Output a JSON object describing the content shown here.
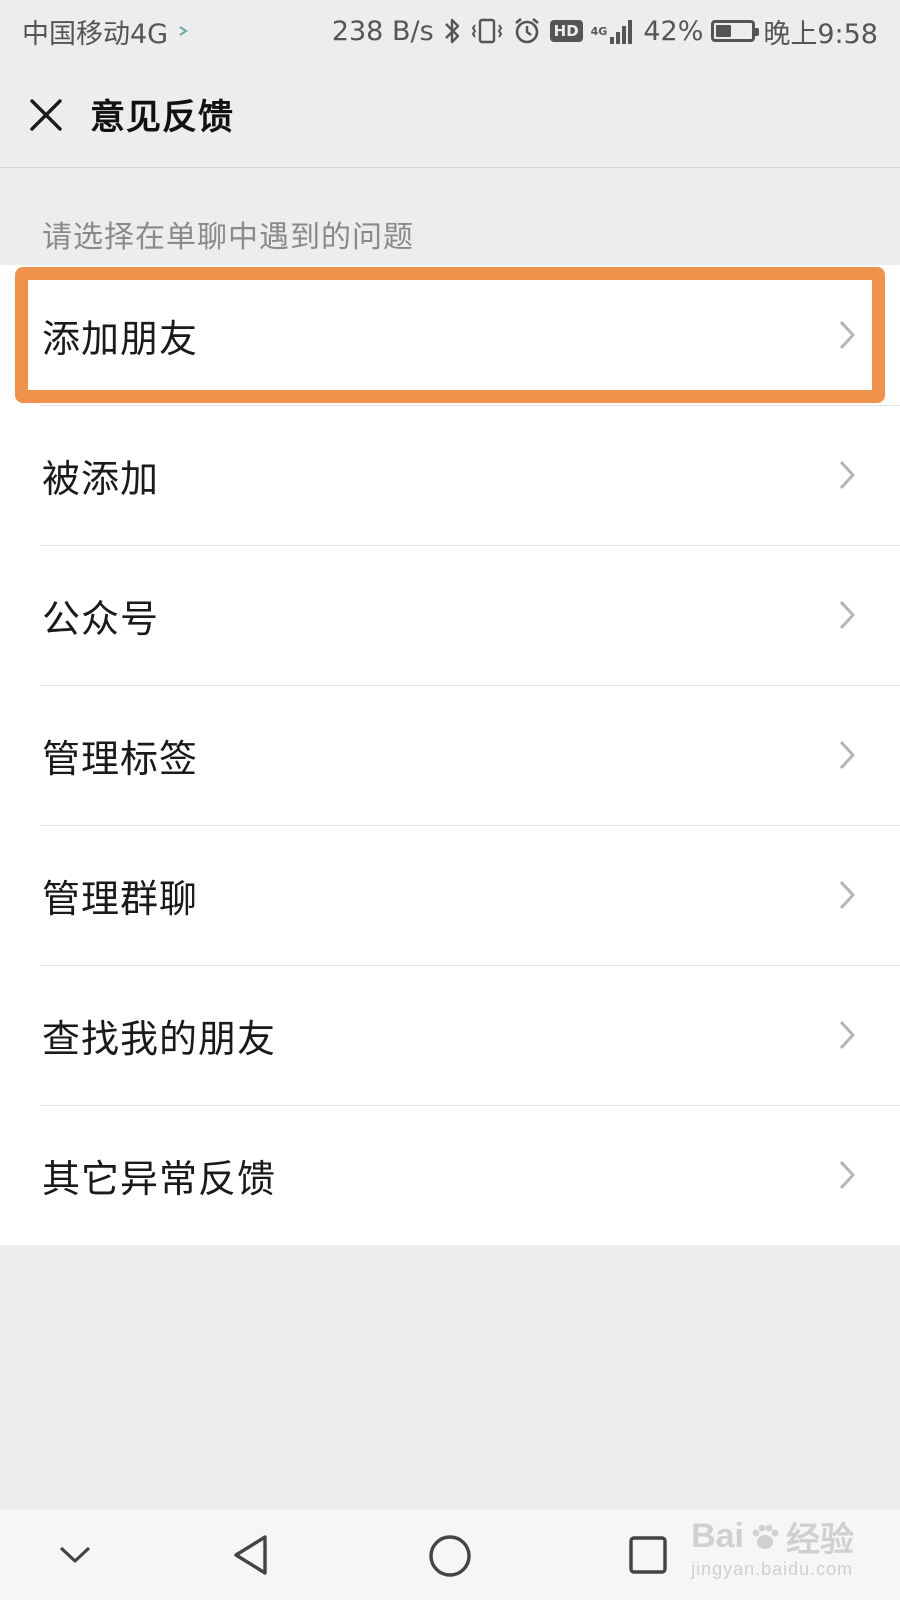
{
  "status_bar": {
    "carrier": "中国移动4G",
    "net_speed": "238 B/s",
    "network_badge": "HD",
    "signal_label": "4G",
    "battery_percent": "42%",
    "battery_level": 0.42,
    "time": "晚上9:58",
    "icons": [
      "bluetooth-icon",
      "vibrate-icon",
      "alarm-icon",
      "hd-icon",
      "signal-icon",
      "battery-icon"
    ]
  },
  "header": {
    "close_icon": "close-icon",
    "title": "意见反馈"
  },
  "section": {
    "caption": "请选择在单聊中遇到的问题"
  },
  "list": {
    "items": [
      {
        "label": "添加朋友",
        "highlighted": true
      },
      {
        "label": "被添加"
      },
      {
        "label": "公众号"
      },
      {
        "label": "管理标签"
      },
      {
        "label": "管理群聊"
      },
      {
        "label": "查找我的朋友"
      },
      {
        "label": "其它异常反馈"
      }
    ]
  },
  "colors": {
    "highlight": "#f0924a",
    "background": "#ededed",
    "list_background": "#ffffff"
  },
  "nav_bar": {
    "buttons": [
      "chevron-down-icon",
      "back-triangle-icon",
      "home-circle-icon",
      "recents-square-icon"
    ]
  },
  "watermark": {
    "brand": "Bai",
    "brand_suffix": "经验",
    "url": "jingyan.baidu.com"
  }
}
